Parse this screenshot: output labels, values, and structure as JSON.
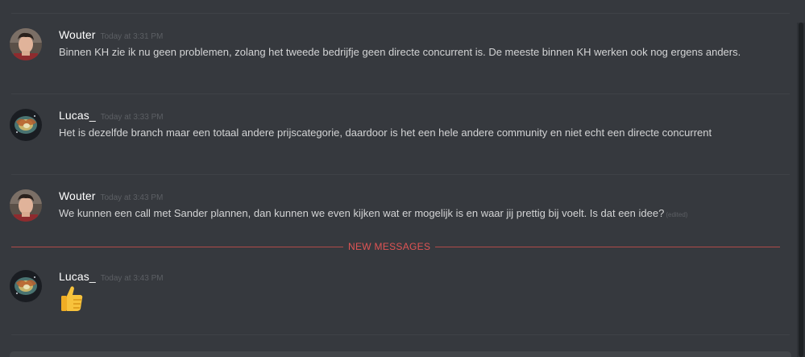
{
  "messages": [
    {
      "author": "Wouter",
      "timestamp": "Today at 3:31 PM",
      "text": "Binnen KH zie ik nu geen problemen, zolang het tweede bedrijfje geen directe concurrent is. De meeste binnen KH werken ook nog ergens anders."
    },
    {
      "author": "Lucas_",
      "timestamp": "Today at 3:33 PM",
      "text": "Het is dezelfde branch maar een totaal andere prijscategorie, daardoor is het een hele andere community en niet echt een directe concurrent"
    },
    {
      "author": "Wouter",
      "timestamp": "Today at 3:43 PM",
      "text": "We kunnen een call met Sander plannen, dan kunnen we even kijken wat er mogelijk is en waar jij prettig bij voelt. Is dat een idee?",
      "edited": "(edited)"
    },
    {
      "author": "Lucas_",
      "timestamp": "Today at 3:43 PM",
      "emoji": "thumbs-up-icon"
    }
  ],
  "new_messages_label": "NEW MESSAGES",
  "colors": {
    "background": "#36393e",
    "new_messages": "#e05454",
    "author": "#ffffff",
    "body_text": "#d3d4d5",
    "timestamp": "#5c5f64"
  }
}
